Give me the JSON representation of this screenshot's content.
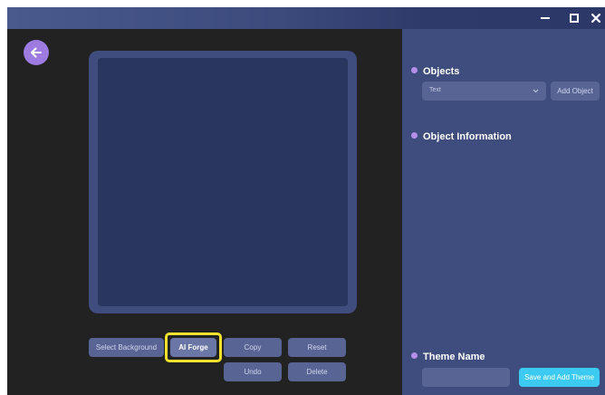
{
  "window": {
    "accent": "#9d7be0",
    "panel_color": "#3e4d7e",
    "highlight_color": "#f2e22e"
  },
  "icons": {
    "back": "arrow-left-icon",
    "minimize": "minimize-icon",
    "maximize": "maximize-icon",
    "close": "close-icon",
    "dropdown": "chevron-down-icon"
  },
  "editor": {
    "buttons": {
      "select_background": "Select Background",
      "ai_forge": "AI Forge",
      "copy": "Copy",
      "reset": "Reset",
      "undo": "Undo",
      "delete": "Delete"
    }
  },
  "sidebar": {
    "objects": {
      "title": "Objects",
      "selected": "Text",
      "add_label": "Add Object"
    },
    "object_information": {
      "title": "Object Information"
    },
    "theme": {
      "title": "Theme Name",
      "value": "",
      "save_label": "Save and Add Theme",
      "save_color": "#3ccaf3"
    }
  }
}
